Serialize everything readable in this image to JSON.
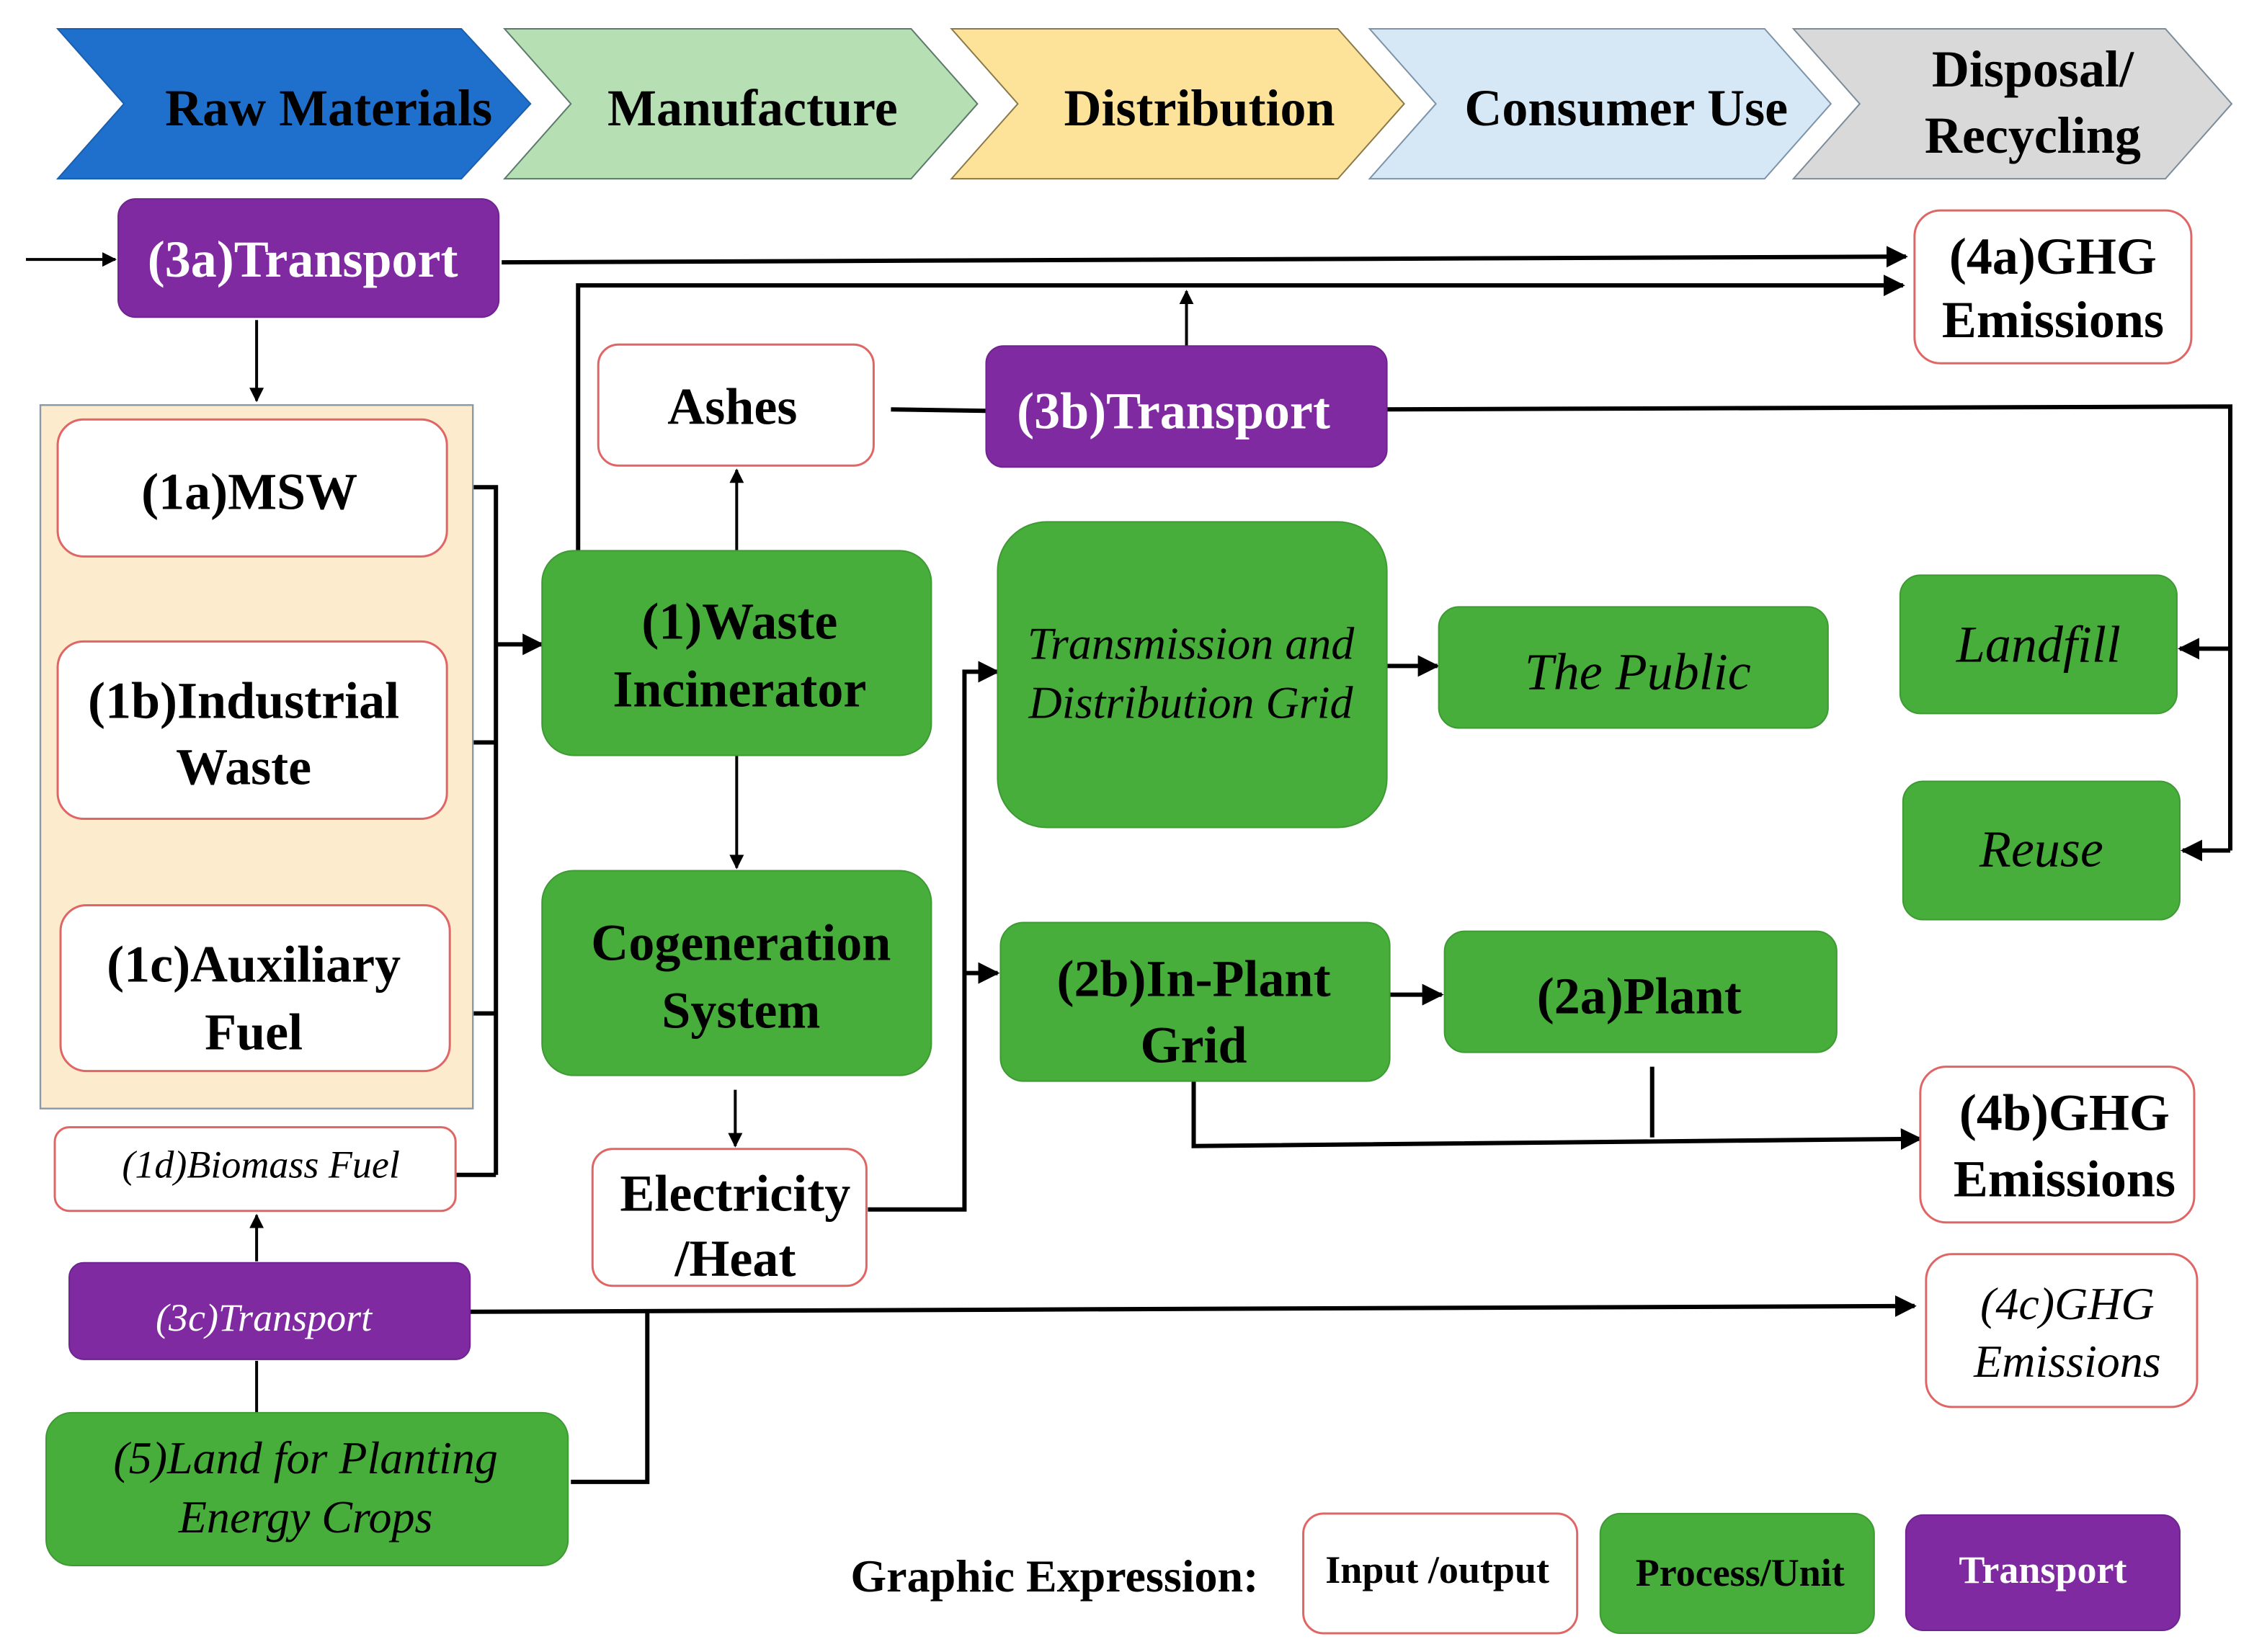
{
  "stages": [
    {
      "label_lines": [
        "Raw Materials"
      ],
      "color": "#1f6fcc"
    },
    {
      "label_lines": [
        "Manufacture"
      ],
      "color": "#b6dfb4"
    },
    {
      "label_lines": [
        "Distribution"
      ],
      "color": "#fde399"
    },
    {
      "label_lines": [
        "Consumer Use"
      ],
      "color": "#d6e8f6"
    },
    {
      "label_lines": [
        "Disposal/",
        "Recycling"
      ],
      "color": "#d9d9d9"
    }
  ],
  "nodes": {
    "transport_3a": {
      "lines": [
        "(3a)Transport"
      ],
      "type": "transport"
    },
    "ghg_4a": {
      "lines": [
        "(4a)GHG",
        "Emissions"
      ],
      "type": "input_output"
    },
    "ashes": {
      "lines": [
        "Ashes"
      ],
      "type": "input_output"
    },
    "transport_3b": {
      "lines": [
        "(3b)Transport"
      ],
      "type": "transport"
    },
    "msw_1a": {
      "lines": [
        "(1a)MSW"
      ],
      "type": "input_output"
    },
    "industrial_waste_1b": {
      "lines": [
        "(1b)Industrial",
        "Waste"
      ],
      "type": "input_output"
    },
    "auxiliary_fuel_1c": {
      "lines": [
        "(1c)Auxiliary",
        "Fuel"
      ],
      "type": "input_output"
    },
    "biomass_fuel_1d": {
      "lines": [
        "(1d)Biomass Fuel"
      ],
      "type": "input_output"
    },
    "waste_incinerator_1": {
      "lines": [
        "(1)Waste",
        "Incinerator"
      ],
      "type": "process"
    },
    "transmission_grid": {
      "lines": [
        "Transmission and",
        "Distribution Grid"
      ],
      "type": "process"
    },
    "the_public": {
      "lines": [
        "The Public"
      ],
      "type": "process"
    },
    "landfill": {
      "lines": [
        "Landfill"
      ],
      "type": "process"
    },
    "reuse": {
      "lines": [
        "Reuse"
      ],
      "type": "process"
    },
    "cogeneration": {
      "lines": [
        "Cogeneration",
        "System"
      ],
      "type": "process"
    },
    "in_plant_grid_2b": {
      "lines": [
        "(2b)In-Plant",
        "Grid"
      ],
      "type": "process"
    },
    "plant_2a": {
      "lines": [
        "(2a)Plant"
      ],
      "type": "process"
    },
    "ghg_4b": {
      "lines": [
        "(4b)GHG",
        "Emissions"
      ],
      "type": "input_output"
    },
    "electricity_heat": {
      "lines": [
        "Electricity",
        "/Heat"
      ],
      "type": "input_output"
    },
    "transport_3c": {
      "lines": [
        "(3c)Transport"
      ],
      "type": "transport"
    },
    "ghg_4c": {
      "lines": [
        "(4c)GHG",
        "Emissions"
      ],
      "type": "input_output"
    },
    "land_5": {
      "lines": [
        "(5)Land for Planting",
        "Energy Crops"
      ],
      "type": "process"
    }
  },
  "legend": {
    "title": "Graphic Expression:",
    "items": [
      {
        "label": "Input /output",
        "type": "input_output"
      },
      {
        "label": "Process/Unit",
        "type": "process"
      },
      {
        "label": "Transport",
        "type": "transport"
      }
    ]
  },
  "colors": {
    "process": "#47ad3b",
    "transport": "#7f2aa0",
    "input_output_border": "#e06666",
    "group_background": "#fdebcd"
  }
}
